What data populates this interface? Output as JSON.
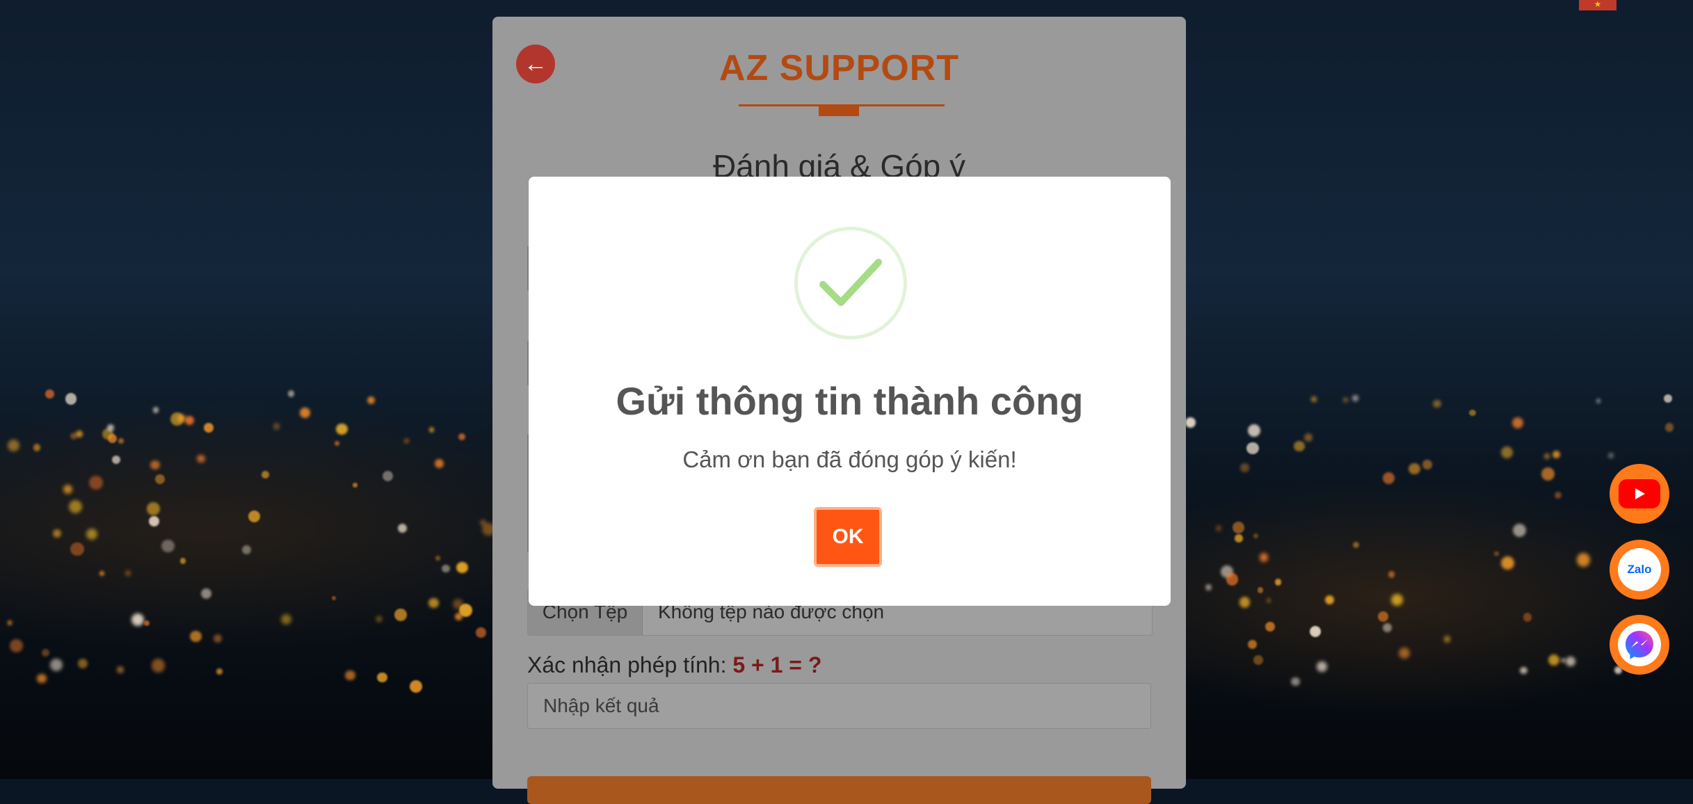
{
  "page": {
    "brand": "AZ SUPPORT",
    "form_title": "Đánh giá & Góp ý",
    "file_button": "Chọn Tệp",
    "file_status": "Không tệp nào được chọn",
    "captcha_label": "Xác nhận phép tính: ",
    "captcha_equation": "5 + 1 = ?",
    "result_placeholder": "Nhập kết quả"
  },
  "modal": {
    "title": "Gửi thông tin thành công",
    "message": "Cảm ơn bạn đã đóng góp ý kiến!",
    "ok_label": "OK",
    "icon": "success-check-icon",
    "check_color": "#a5dc86"
  },
  "social": {
    "youtube_icon": "youtube-icon",
    "zalo_label": "Zalo",
    "messenger_icon": "messenger-icon",
    "accent": "#ff7a1a"
  },
  "colors": {
    "brand": "#b34a12",
    "ok_button": "#ff5613",
    "captcha_equation": "#7a1a1a"
  }
}
